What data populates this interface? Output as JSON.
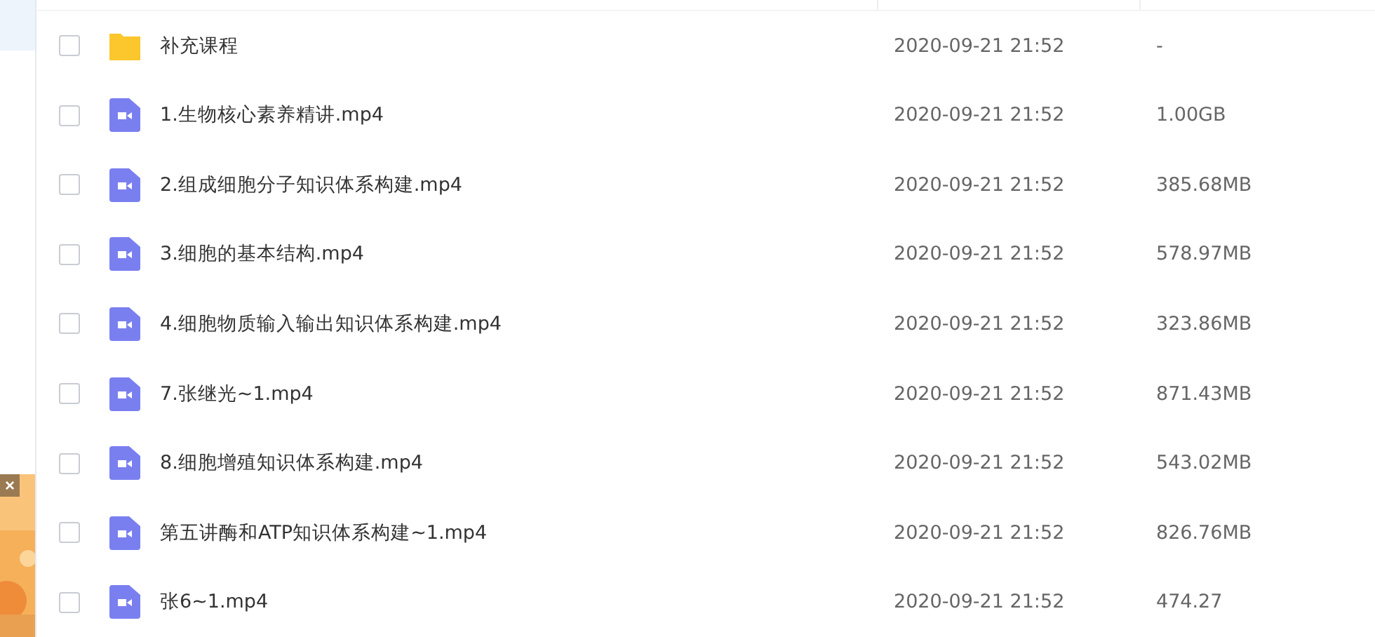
{
  "side_ad": {
    "close": "×"
  },
  "files": [
    {
      "kind": "folder",
      "name": "补充课程",
      "modified": "2020-09-21 21:52",
      "size": "-",
      "checked": false
    },
    {
      "kind": "video",
      "name": "1.生物核心素养精讲.mp4",
      "modified": "2020-09-21 21:52",
      "size": "1.00GB",
      "checked": false
    },
    {
      "kind": "video",
      "name": "2.组成细胞分子知识体系构建.mp4",
      "modified": "2020-09-21 21:52",
      "size": "385.68MB",
      "checked": false
    },
    {
      "kind": "video",
      "name": "3.细胞的基本结构.mp4",
      "modified": "2020-09-21 21:52",
      "size": "578.97MB",
      "checked": false
    },
    {
      "kind": "video",
      "name": "4.细胞物质输入输出知识体系构建.mp4",
      "modified": "2020-09-21 21:52",
      "size": "323.86MB",
      "checked": false
    },
    {
      "kind": "video",
      "name": "7.张继光~1.mp4",
      "modified": "2020-09-21 21:52",
      "size": "871.43MB",
      "checked": false
    },
    {
      "kind": "video",
      "name": "8.细胞增殖知识体系构建.mp4",
      "modified": "2020-09-21 21:52",
      "size": "543.02MB",
      "checked": false
    },
    {
      "kind": "video",
      "name": "第五讲酶和ATP知识体系构建~1.mp4",
      "modified": "2020-09-21 21:52",
      "size": "826.76MB",
      "checked": false
    },
    {
      "kind": "video",
      "name": "张6~1.mp4",
      "modified": "2020-09-21 21:52",
      "size": "474.27",
      "checked": false
    }
  ]
}
